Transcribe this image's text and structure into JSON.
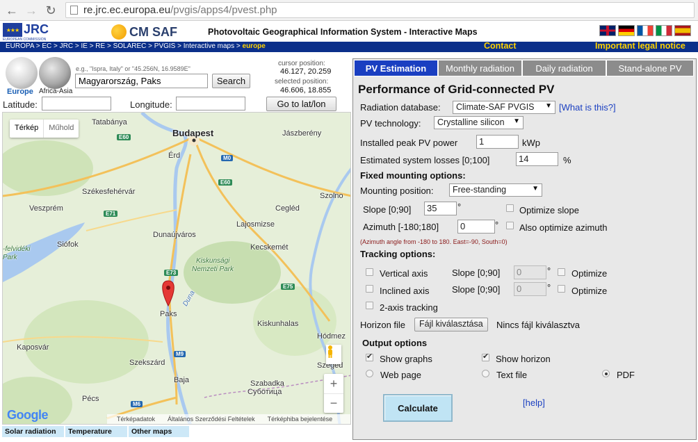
{
  "browser": {
    "url_host": "re.jrc.ec.europa.eu",
    "url_path": "/pvgis/apps4/pvest.php"
  },
  "header": {
    "jrc_logo_text": "JRC",
    "jrc_logo_sub": "EUROPEAN COMMISSION",
    "cmsaf_logo_text": "CM SAF",
    "title": "Photovoltaic Geographical Information System - Interactive Maps",
    "breadcrumb": "EUROPA > EC > JRC > IE > RE > SOLAREC > PVGIS > Interactive maps >",
    "breadcrumb_current": "europe",
    "contact": "Contact",
    "legal": "Important legal notice"
  },
  "search": {
    "globe_eu_label": "Europe",
    "globe_af_label": "Africa-Asia",
    "hint": "e.g., \"Ispra, Italy\" or \"45.256N, 16.9589E\"",
    "value": "Magyarország, Paks",
    "search_button": "Search",
    "cursor_label": "cursor position:",
    "cursor_value": "46.127, 20.259",
    "selected_label": "selected position:",
    "selected_value": "46.606, 18.855",
    "lat_label": "Latitude:",
    "lon_label": "Longitude:",
    "goto_button": "Go to lat/lon"
  },
  "map": {
    "type_map": "Térkép",
    "type_satellite": "Műhold",
    "google": "Google",
    "footer": [
      "Térképadatok",
      "Általános Szerződési Feltételek",
      "Térképhiba bejelentése"
    ],
    "cities": {
      "tatabanya": "Tatabánya",
      "budapest": "Budapest",
      "jaszbereny": "Jászberény",
      "erd": "Érd",
      "szekesfehervar": "Székesfehérvár",
      "szolno": "Szolno",
      "veszprem": "Veszprém",
      "cegled": "Cegléd",
      "lajosmizse": "Lajosmizse",
      "dunaujvaros": "Dunaújváros",
      "siofok": "Siófok",
      "kecskemet": "Kecskemét",
      "felvideki": "-felvidéki",
      "park1": "Park",
      "kiskunsagi": "Kiskunsági",
      "nemzeti_park": "Nemzeti Park",
      "duna": "Duna",
      "paks": "Paks",
      "kiskunhalas": "Kiskunhalas",
      "hodmez": "Hódmez",
      "kaposvar": "Kaposvár",
      "szekszard": "Szekszárd",
      "szeged": "Szeged",
      "baja": "Baja",
      "szabadka": "Szabadka",
      "subotica": "Суботица",
      "pecs": "Pécs"
    },
    "shields": {
      "e60a": "E60",
      "m0": "M0",
      "e60b": "E60",
      "e71": "E71",
      "e73": "E73",
      "e75": "E75",
      "m9": "M9",
      "m6": "M6"
    }
  },
  "bottom_tabs": [
    "Solar radiation",
    "Temperature",
    "Other maps"
  ],
  "panel": {
    "tabs": [
      "PV Estimation",
      "Monthly radiation",
      "Daily radiation",
      "Stand-alone PV"
    ],
    "title": "Performance of Grid-connected PV",
    "radiation_db_label": "Radiation database:",
    "radiation_db_value": "Climate-SAF PVGIS",
    "what_is_this": "[What is this?]",
    "pv_tech_label": "PV technology:",
    "pv_tech_value": "Crystalline silicon",
    "peak_power_label": "Installed peak PV power",
    "peak_power_value": "1",
    "peak_power_unit": "kWp",
    "losses_label": "Estimated system losses [0;100]",
    "losses_value": "14",
    "losses_unit": "%",
    "fixed_heading": "Fixed mounting options:",
    "mounting_label": "Mounting position:",
    "mounting_value": "Free-standing",
    "slope_label": "Slope [0;90]",
    "slope_value": "35",
    "deg": "°",
    "optimize_slope": "Optimize slope",
    "azimuth_label": "Azimuth [-180;180]",
    "azimuth_value": "0",
    "also_optimize_azimuth": "Also optimize azimuth",
    "azimuth_note": "(Azimuth angle from -180 to 180. East=-90, South=0)",
    "tracking_heading": "Tracking options:",
    "vertical_axis": "Vertical axis",
    "inclined_axis": "Inclined axis",
    "tracking_slope_label": "Slope [0;90]",
    "tracking_slope_value": "0",
    "optimize": "Optimize",
    "two_axis": "2-axis tracking",
    "horizon_label": "Horizon file",
    "file_button": "Fájl kiválasztása",
    "no_file": "Nincs fájl kiválasztva",
    "output_heading": "Output options",
    "show_graphs": "Show graphs",
    "show_horizon": "Show horizon",
    "web_page": "Web page",
    "text_file": "Text file",
    "pdf": "PDF",
    "calculate": "Calculate",
    "help": "[help]"
  }
}
